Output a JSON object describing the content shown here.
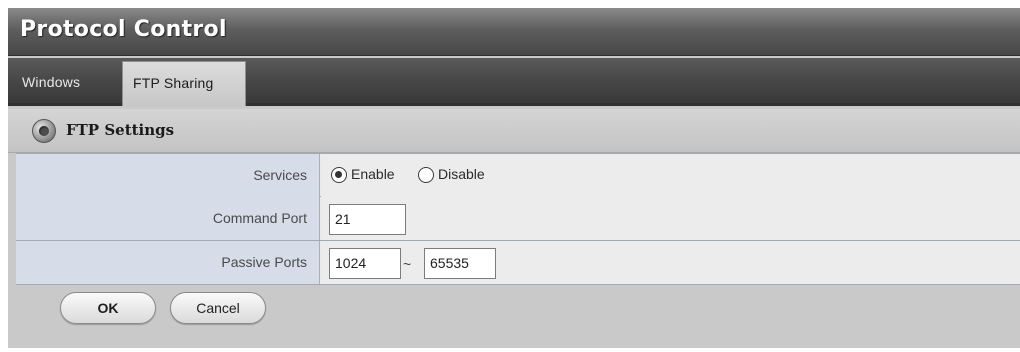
{
  "window": {
    "title": "Protocol Control"
  },
  "tabs": [
    {
      "label": "Windows",
      "active": false
    },
    {
      "label": "FTP Sharing",
      "active": true
    }
  ],
  "section": {
    "title": "FTP Settings",
    "icon": "ftp-settings-icon"
  },
  "form": {
    "services": {
      "label": "Services",
      "options": [
        {
          "label": "Enable",
          "checked": true
        },
        {
          "label": "Disable",
          "checked": false
        }
      ]
    },
    "command_port": {
      "label": "Command Port",
      "value": "21"
    },
    "passive_ports": {
      "label": "Passive Ports",
      "from": "1024",
      "separator": "~",
      "to": "65535"
    }
  },
  "buttons": {
    "ok_label": "OK",
    "cancel_label": "Cancel"
  },
  "colors": {
    "title_bar": "#5e5e5e",
    "label_cell": "#d6dde8",
    "panel_bg": "#c9c9c9"
  }
}
